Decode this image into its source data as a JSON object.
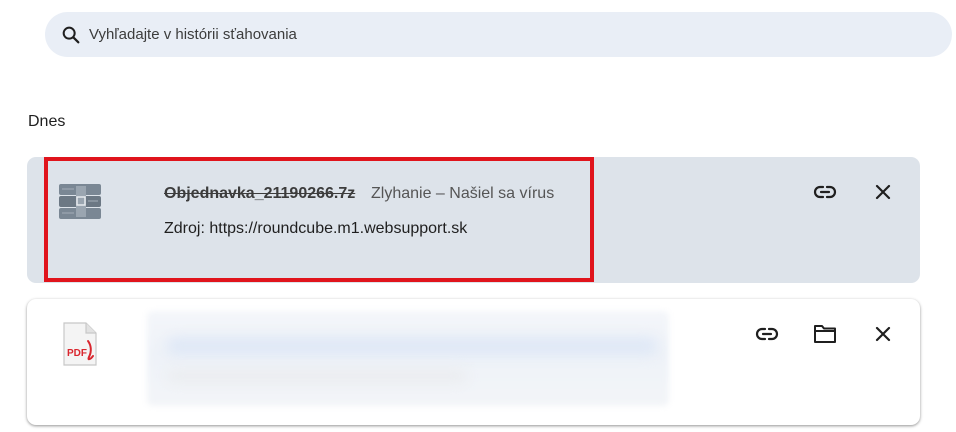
{
  "search": {
    "placeholder": "Vyhľadajte v histórii sťahovania"
  },
  "section": {
    "title": "Dnes"
  },
  "downloads": [
    {
      "file_name": "Objednavka_21190266.7z",
      "status": "Zlyhanie – Našiel sa vírus",
      "source": "Zdroj: https://roundcube.m1.websupport.sk",
      "icon": "archive-icon",
      "actions": [
        "copy-link-icon",
        "close-icon"
      ]
    },
    {
      "icon": "pdf-file-icon",
      "icon_label": "PDF",
      "details_blurred": true,
      "actions": [
        "copy-link-icon",
        "folder-icon",
        "close-icon"
      ]
    }
  ],
  "colors": {
    "search_bg": "#e9eef6",
    "failed_card_bg": "#dde3ea",
    "highlight_border": "#e0141c",
    "pdf_red": "#d9262e"
  }
}
